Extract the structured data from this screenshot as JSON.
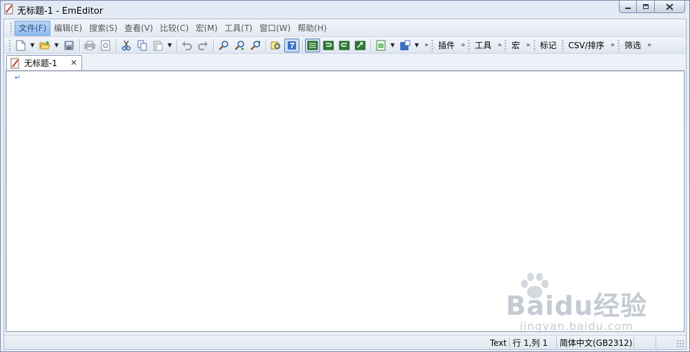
{
  "window": {
    "title": "无标题-1 - EmEditor",
    "controls": [
      "minimize",
      "maximize",
      "close"
    ]
  },
  "menu": {
    "items": [
      {
        "label": "文件(F)",
        "active": true
      },
      {
        "label": "编辑(E)"
      },
      {
        "label": "搜索(S)"
      },
      {
        "label": "查看(V)"
      },
      {
        "label": "比较(C)"
      },
      {
        "label": "宏(M)"
      },
      {
        "label": "工具(T)"
      },
      {
        "label": "窗口(W)"
      },
      {
        "label": "帮助(H)"
      }
    ]
  },
  "toolbar": {
    "groups": [
      {
        "label": "插件"
      },
      {
        "label": "工具"
      },
      {
        "label": "宏"
      },
      {
        "label": "标记"
      },
      {
        "label": "CSV/排序"
      },
      {
        "label": "筛选"
      }
    ],
    "icons": [
      "new-file-icon",
      "open-file-icon",
      "save-icon",
      "print-icon",
      "print-preview-icon",
      "cut-icon",
      "copy-icon",
      "paste-icon",
      "undo-icon",
      "redo-icon",
      "find-icon",
      "find-next-icon",
      "find-prev-icon",
      "highlight-icon",
      "filter-icon",
      "wrap-none-icon",
      "wrap-window-icon",
      "wrap-char-icon",
      "wrap-page-icon",
      "encoding-icon",
      "config-icon"
    ]
  },
  "tabs": [
    {
      "label": "无标题-1",
      "close": "✕"
    }
  ],
  "editor": {
    "eol_mark": "↵"
  },
  "status": {
    "mode": "Text",
    "position": "行 1,列 1",
    "encoding": "简体中文(GB2312)"
  },
  "watermark": {
    "logo": "Baidu经验",
    "url": "jingyan.baidu.com"
  },
  "colors": {
    "accent": "#8fbcef",
    "border": "#8e9cb3",
    "eol": "#3a7bd5"
  }
}
